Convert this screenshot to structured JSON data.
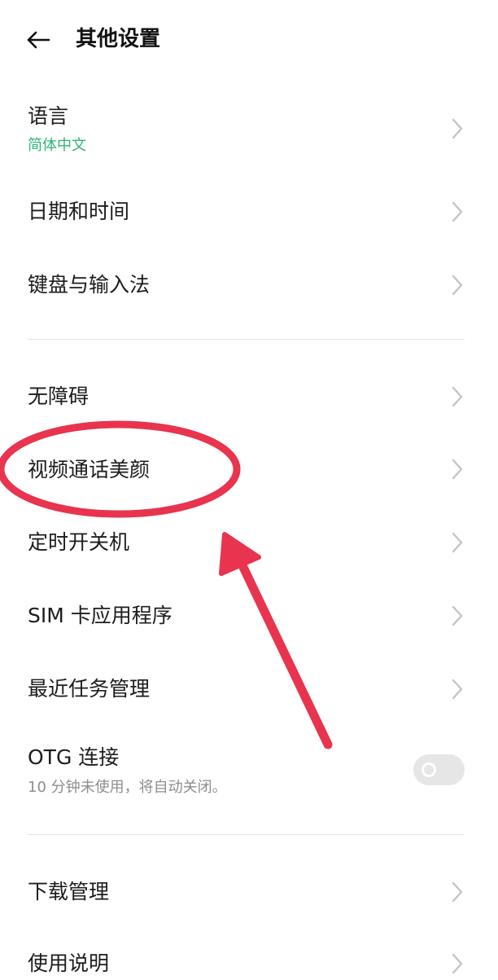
{
  "header": {
    "title": "其他设置",
    "back_icon": "arrow-left-icon"
  },
  "items": [
    {
      "label": "语言",
      "subtitle": "简体中文"
    },
    {
      "label": "日期和时间"
    },
    {
      "label": "键盘与输入法"
    },
    {
      "label": "无障碍"
    },
    {
      "label": "视频通话美颜"
    },
    {
      "label": "定时开关机"
    },
    {
      "label": "SIM 卡应用程序"
    },
    {
      "label": "最近任务管理"
    },
    {
      "label": "OTG 连接",
      "subtitle": "10 分钟未使用，将自动关闭。",
      "toggle": "off"
    },
    {
      "label": "下载管理"
    },
    {
      "label": "使用说明"
    }
  ],
  "colors": {
    "accent_green": "#2fb37a",
    "annotation_red": "#e8344e",
    "toggle_off": "#e6e6e6"
  }
}
